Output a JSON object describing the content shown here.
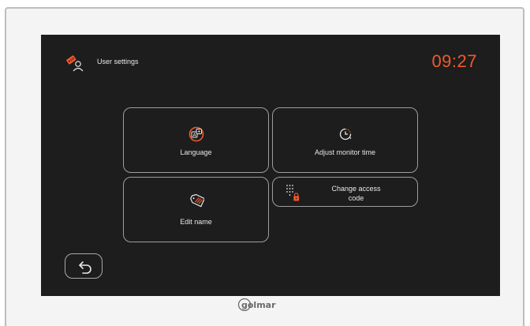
{
  "header": {
    "title": "User settings",
    "clock": "09:27"
  },
  "tiles": {
    "language": "Language",
    "adjust_time": "Adjust monitor time",
    "edit_name": "Edit name",
    "change_code_line1": "Change access",
    "change_code_line2": "code"
  },
  "icons": {
    "header": "user-settings-icon",
    "language": "language-icon",
    "adjust_time": "clock-icon",
    "edit_name": "tag-icon",
    "change_code": "keypad-lock-icon",
    "back": "back-arrow-icon",
    "brand": "golmar-logo"
  },
  "brand": {
    "name": "golmar"
  },
  "colors": {
    "accent": "#f2592b",
    "screen": "#1d1d1d",
    "text": "#e8e8e8",
    "border": "#9d9d9d"
  }
}
